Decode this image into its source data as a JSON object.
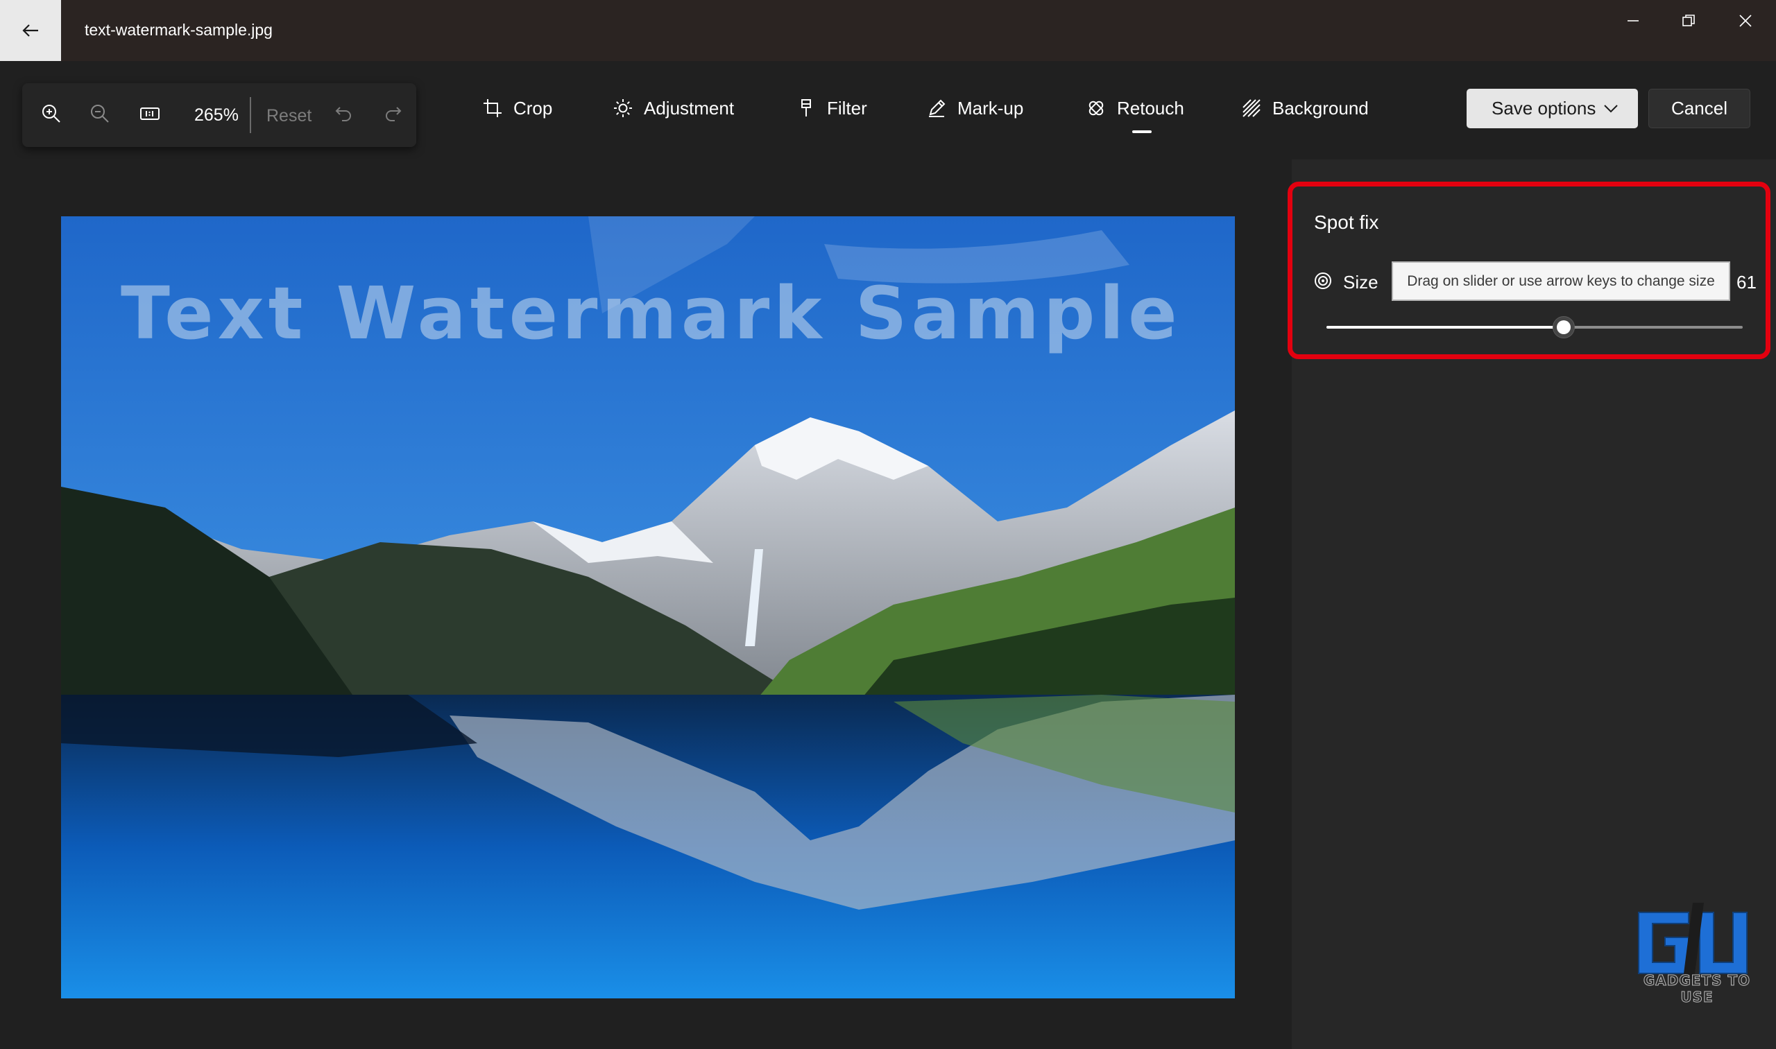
{
  "window": {
    "title": "text-watermark-sample.jpg"
  },
  "zoom_toolbar": {
    "zoom_level": "265%",
    "reset_label": "Reset"
  },
  "tools": [
    {
      "label": "Crop",
      "icon": "crop-icon"
    },
    {
      "label": "Adjustment",
      "icon": "brightness-icon"
    },
    {
      "label": "Filter",
      "icon": "filter-icon"
    },
    {
      "label": "Mark-up",
      "icon": "pen-icon"
    },
    {
      "label": "Retouch",
      "icon": "retouch-icon",
      "selected": true
    },
    {
      "label": "Background",
      "icon": "background-icon"
    }
  ],
  "actions": {
    "save_options_label": "Save options",
    "cancel_label": "Cancel"
  },
  "image": {
    "watermark_text": "Text Watermark Sample"
  },
  "panel": {
    "title": "Spot fix",
    "size_label": "Size",
    "size_tooltip": "Drag on slider or use arrow keys to change size",
    "size_value": "61",
    "slider_fraction": 0.57
  },
  "logo": {
    "text": "GADGETS TO USE"
  },
  "colors": {
    "highlight": "#e3000f",
    "titlebar": "#2b2422",
    "panel": "#272727"
  }
}
